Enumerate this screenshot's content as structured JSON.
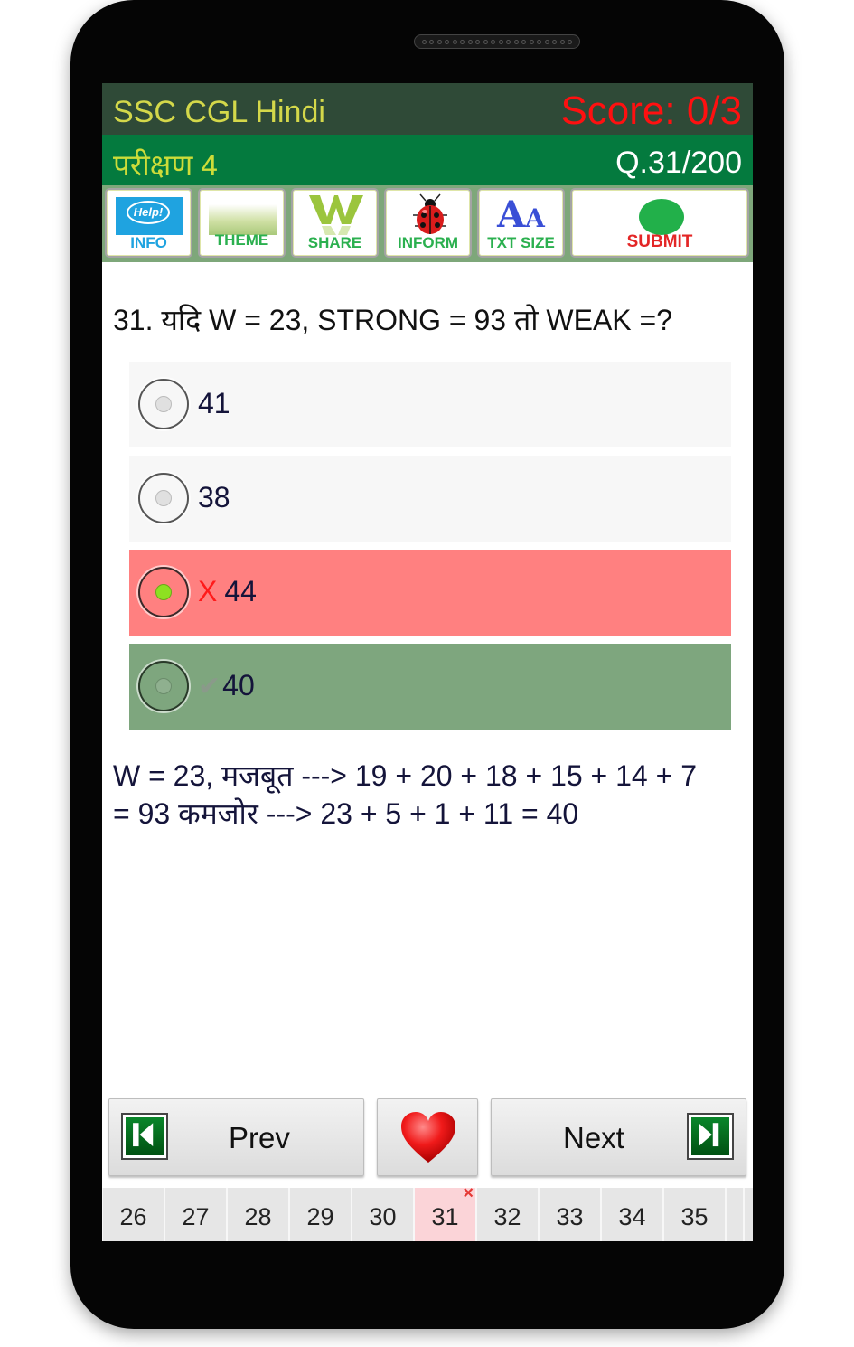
{
  "header": {
    "app_title": "SSC CGL Hindi",
    "score": "Score: 0/3",
    "test_name": "परीक्षण 4",
    "question_counter": "Q.31/200"
  },
  "toolbar": {
    "items": [
      {
        "label": "INFO",
        "icon": "help-bubble-icon",
        "color": "#1fa3e0"
      },
      {
        "label": "THEME",
        "icon": "theme-gradient-icon",
        "color": "#2bb04f"
      },
      {
        "label": "SHARE",
        "icon": "share-w-icon",
        "color": "#2bb04f"
      },
      {
        "label": "INFORM",
        "icon": "ladybug-icon",
        "color": "#2bb04f"
      },
      {
        "label": "TXT SIZE",
        "icon": "text-size-icon",
        "color": "#2bb04f"
      },
      {
        "label": "SUBMIT",
        "icon": "green-dot-icon",
        "color": "#e32626"
      }
    ],
    "text_size_glyph_big": "A",
    "text_size_glyph_small": "A"
  },
  "question": {
    "text": "31. यदि W = 23, STRONG = 93 तो WEAK =?",
    "options": [
      {
        "text": "41",
        "state": "none",
        "mark": ""
      },
      {
        "text": "38",
        "state": "none",
        "mark": ""
      },
      {
        "text": "44",
        "state": "wrong-selected",
        "mark": "X"
      },
      {
        "text": "40",
        "state": "correct",
        "mark": "✔"
      }
    ],
    "colors": {
      "neutral": "#f7f7f7",
      "wrong": "#ff8080",
      "correct": "#7ea67e"
    }
  },
  "explanation": {
    "line1": "W = 23, मजबूत ---> 19 + 20 + 18 + 15 + 14 + 7",
    "line2": "= 93 कमजोर ---> 23 + 5 + 1 + 11 = 40"
  },
  "navigation": {
    "prev_label": "Prev",
    "next_label": "Next"
  },
  "pager": {
    "pages": [
      "26",
      "27",
      "28",
      "29",
      "30",
      "31",
      "32",
      "33",
      "34",
      "35"
    ],
    "current": "31",
    "current_badge": "×"
  }
}
